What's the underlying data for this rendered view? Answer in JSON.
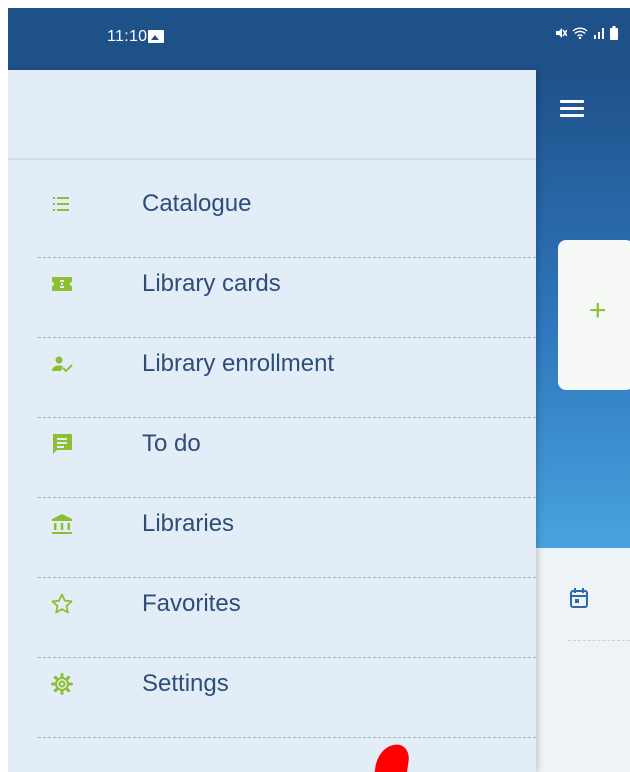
{
  "status_bar": {
    "time": "11:10"
  },
  "drawer": {
    "items": [
      {
        "label": "Catalogue",
        "icon": "list-icon"
      },
      {
        "label": "Library cards",
        "icon": "ticket-icon"
      },
      {
        "label": "Library enrollment",
        "icon": "person-check-icon"
      },
      {
        "label": "To do",
        "icon": "message-icon"
      },
      {
        "label": "Libraries",
        "icon": "bank-icon"
      },
      {
        "label": "Favorites",
        "icon": "star-outline-icon"
      },
      {
        "label": "Settings",
        "icon": "gear-icon"
      }
    ]
  },
  "background": {
    "add_symbol": "+"
  },
  "colors": {
    "accent": "#8cbf32",
    "header_blue": "#1f5189",
    "text": "#2e4d78",
    "drawer_bg": "#e3edf7"
  }
}
